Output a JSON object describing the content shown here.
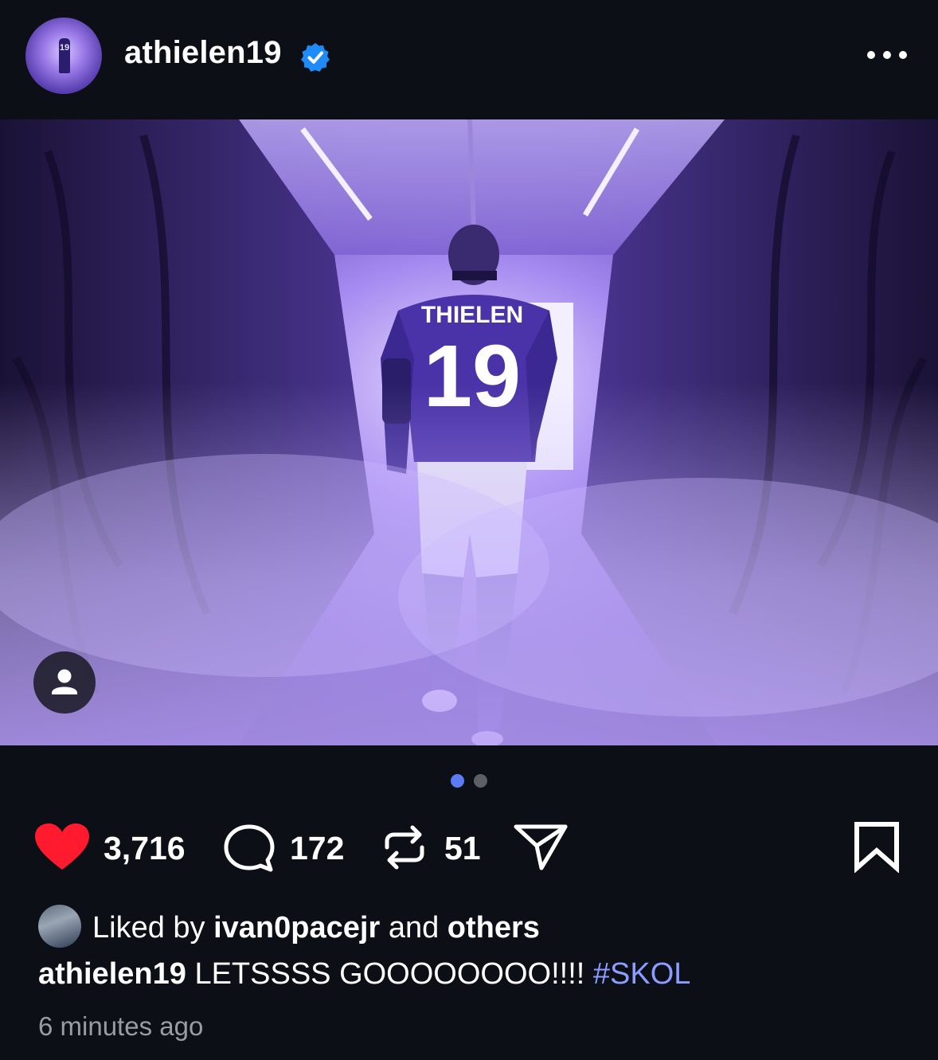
{
  "post": {
    "username": "athielen19",
    "verified": true,
    "avatar_jersey_number": "19",
    "menu_icon": "more-horizontal-icon",
    "photo": {
      "jersey_name": "THIELEN",
      "jersey_number": "19",
      "tag_icon": "person-icon"
    },
    "carousel": {
      "total": 2,
      "current": 1,
      "active_color": "#5b7cf5",
      "inactive_color": "#5c5f66"
    },
    "actions": {
      "likes": "3,716",
      "comments": "172",
      "reposts": "51",
      "like_icon": "heart-filled-icon",
      "comment_icon": "comment-bubble-icon",
      "repost_icon": "repost-icon",
      "share_icon": "send-icon",
      "save_icon": "bookmark-icon",
      "like_color": "#ff1b2d"
    },
    "liked_by": {
      "prefix": "Liked by",
      "user": "ivan0pacejr",
      "connector": "and",
      "others": "others"
    },
    "caption": {
      "username": "athielen19",
      "text": "LETSSSS GOOOOOOOO!!!!",
      "hashtag": "#SKOL"
    },
    "timestamp": "6 minutes ago"
  }
}
